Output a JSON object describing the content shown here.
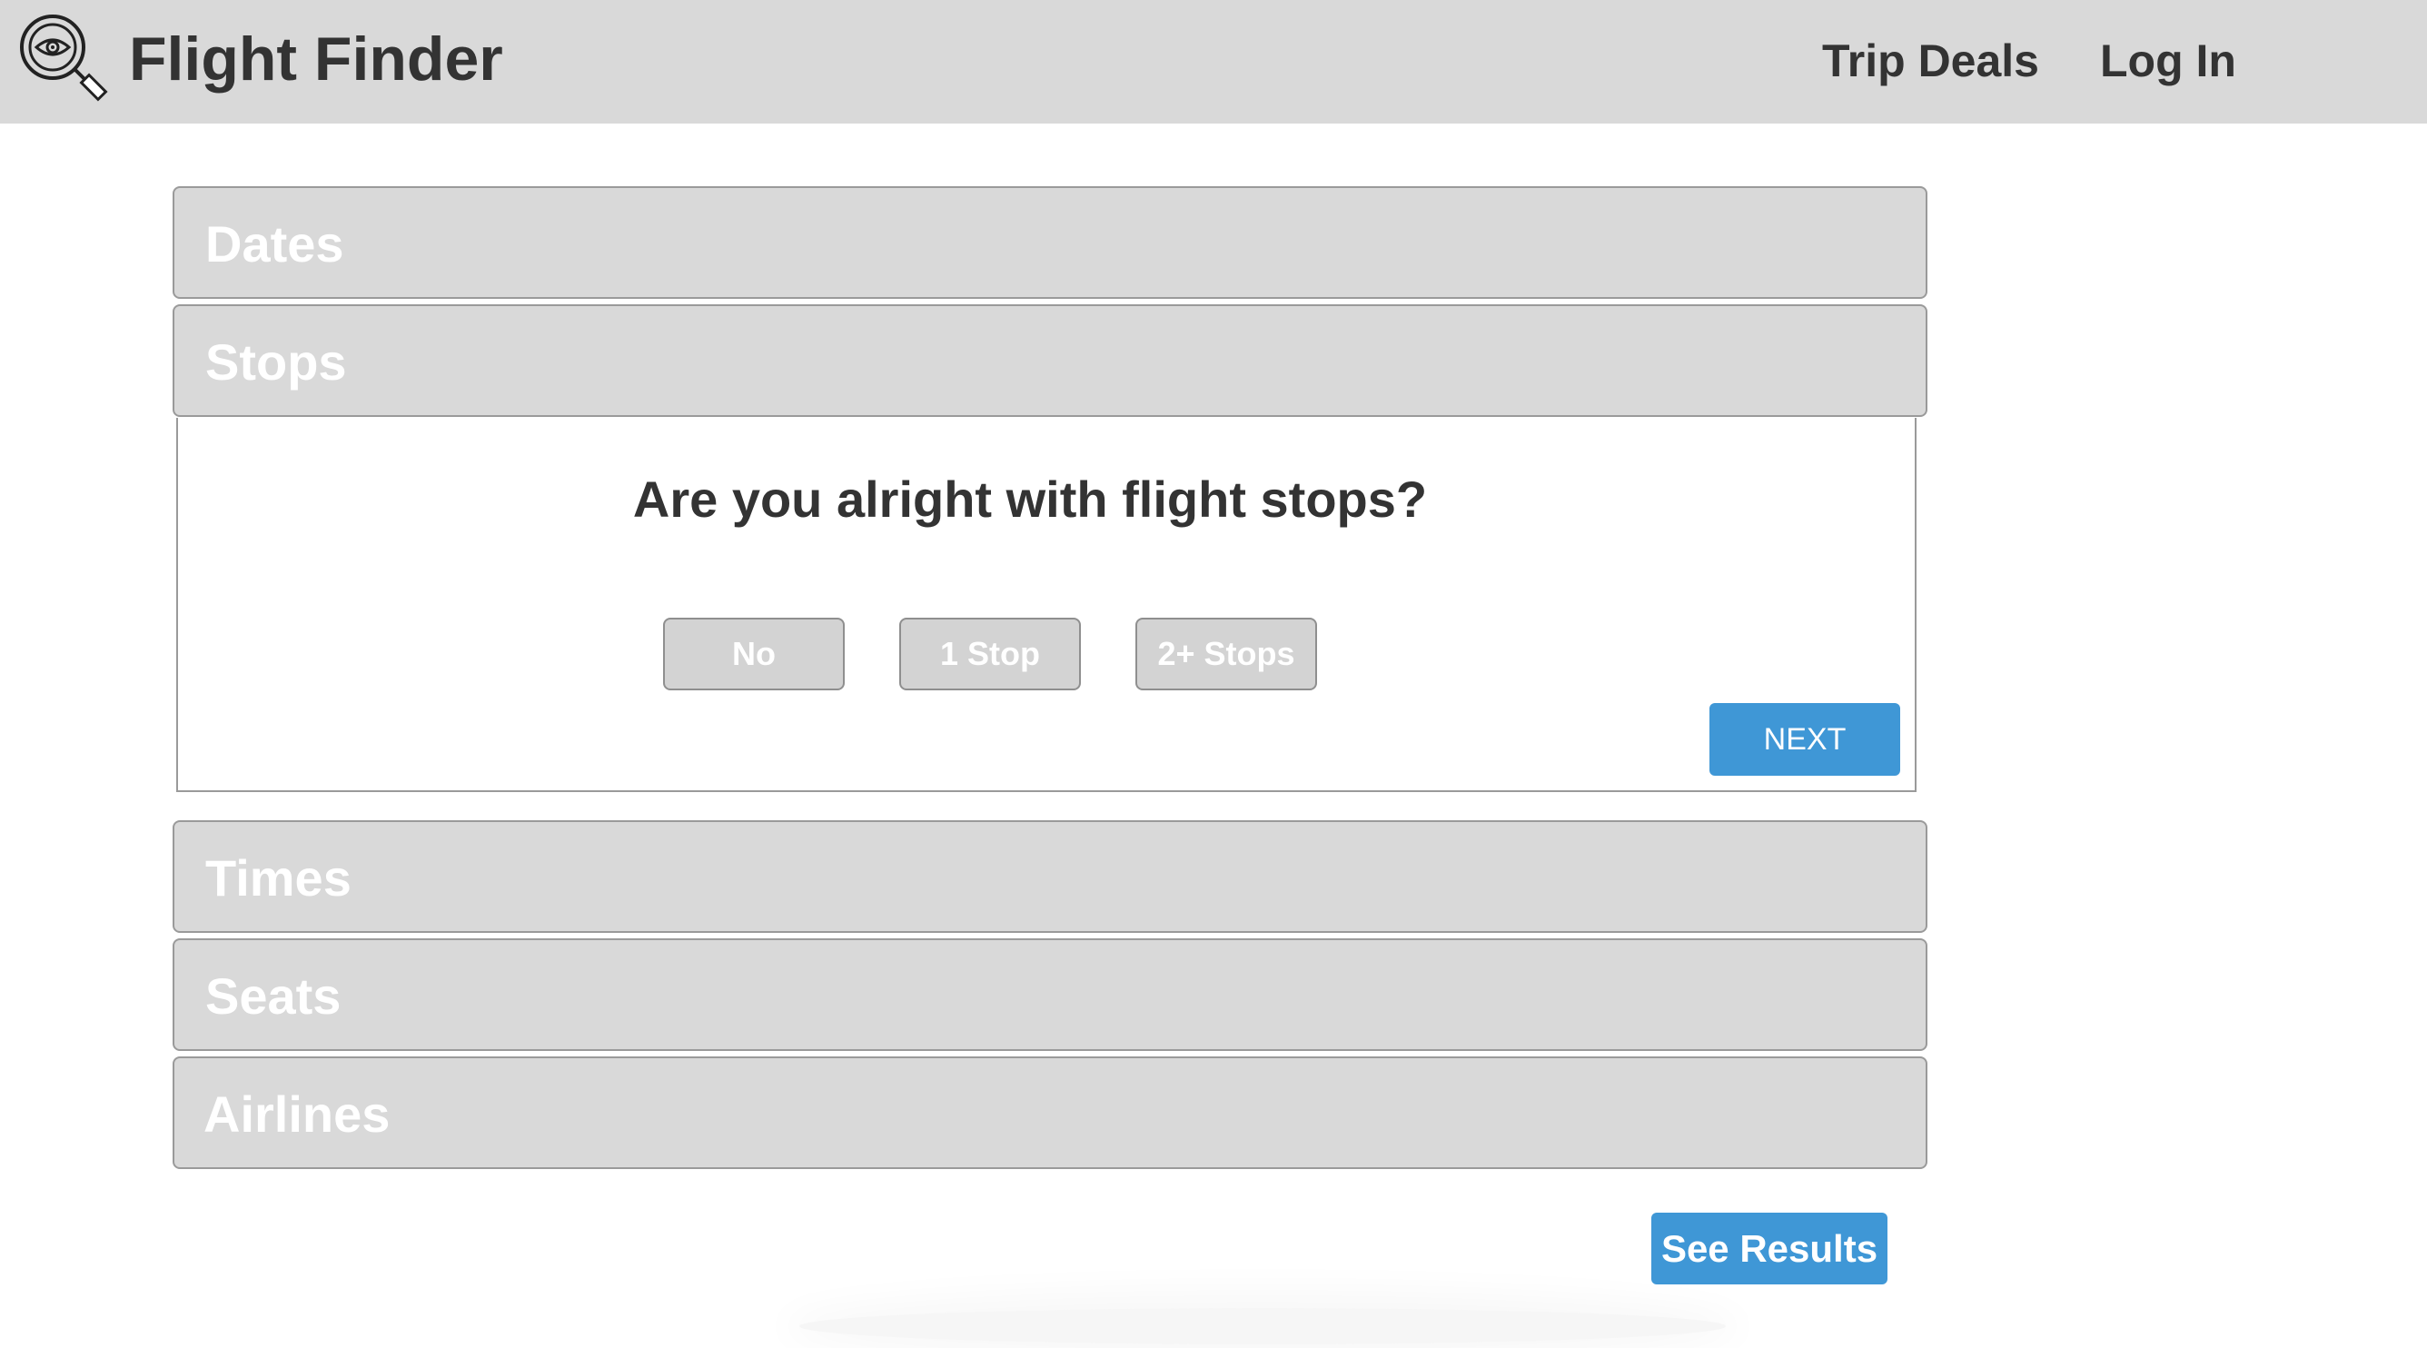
{
  "header": {
    "app_title": "Flight Finder",
    "logo_icon": "magnifier-eye-icon",
    "nav": {
      "trip_deals": "Trip Deals",
      "log_in": "Log In"
    }
  },
  "accordion": {
    "sections": {
      "dates": "Dates",
      "stops": "Stops",
      "times": "Times",
      "seats": "Seats",
      "airlines": "Airlines"
    },
    "expanded": "Stops"
  },
  "stops_panel": {
    "question": "Are you alright with flight stops?",
    "options": {
      "no": "No",
      "one_stop": "1 Stop",
      "two_plus": "2+ Stops"
    },
    "next_label": "NEXT"
  },
  "see_results_label": "See Results",
  "colors": {
    "header_bg": "#d9d9d9",
    "section_bg": "#d9d9d9",
    "accent": "#3f97d6",
    "text_dark": "#333333"
  }
}
